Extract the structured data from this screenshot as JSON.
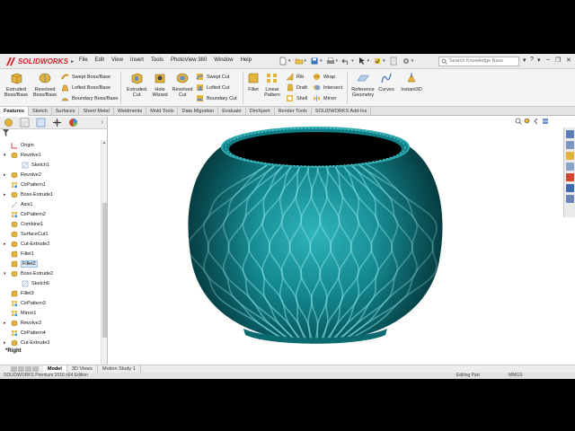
{
  "app": {
    "logo_text": "SOLIDWORKS"
  },
  "menus": [
    "File",
    "Edit",
    "View",
    "Insert",
    "Tools",
    "PhotoView 360",
    "Window",
    "Help"
  ],
  "search": {
    "placeholder": "Search Knowledge Base"
  },
  "commands": {
    "extruded_boss": "Extruded Boss/Base",
    "revolved_boss": "Revolved Boss/Base",
    "swept_boss": "Swept Boss/Base",
    "lofted_boss": "Lofted Boss/Base",
    "boundary_boss": "Boundary Boss/Base",
    "extruded_cut": "Extruded Cut",
    "hole_wizard": "Hole Wizard",
    "revolved_cut": "Revolved Cut",
    "swept_cut": "Swept Cut",
    "lofted_cut": "Lofted Cut",
    "boundary_cut": "Boundary Cut",
    "fillet": "Fillet",
    "linear_pattern": "Linear Pattern",
    "rib": "Rib",
    "draft": "Draft",
    "shell": "Shell",
    "wrap": "Wrap",
    "intersect": "Intersect",
    "mirror": "Mirror",
    "reference_geometry": "Reference Geometry",
    "curves": "Curves",
    "instant3d": "Instant3D"
  },
  "tabs": [
    "Features",
    "Sketch",
    "Surfaces",
    "Sheet Metal",
    "Weldments",
    "Mold Tools",
    "Data Migration",
    "Evaluate",
    "DimXpert",
    "Render Tools",
    "SOLIDWORKS Add-Ins"
  ],
  "tree": [
    {
      "label": "Origin",
      "indent": 0,
      "expand": "",
      "icon": "origin"
    },
    {
      "label": "Revolve1",
      "indent": 0,
      "expand": "▾",
      "icon": "feature"
    },
    {
      "label": "Sketch1",
      "indent": 1,
      "expand": "",
      "icon": "sketch"
    },
    {
      "label": "Revolve2",
      "indent": 0,
      "expand": "▸",
      "icon": "feature"
    },
    {
      "label": "CirPattern1",
      "indent": 0,
      "expand": "",
      "icon": "pattern"
    },
    {
      "label": "Boss-Extrude1",
      "indent": 0,
      "expand": "▸",
      "icon": "feature"
    },
    {
      "label": "Axis1",
      "indent": 0,
      "expand": "",
      "icon": "axis"
    },
    {
      "label": "CirPattern2",
      "indent": 0,
      "expand": "",
      "icon": "pattern"
    },
    {
      "label": "Combine1",
      "indent": 0,
      "expand": "",
      "icon": "feature"
    },
    {
      "label": "SurfaceCut1",
      "indent": 0,
      "expand": "",
      "icon": "feature"
    },
    {
      "label": "Cut-Extrude2",
      "indent": 0,
      "expand": "▸",
      "icon": "feature"
    },
    {
      "label": "Fillet1",
      "indent": 0,
      "expand": "",
      "icon": "fillet"
    },
    {
      "label": "Fillet2",
      "indent": 0,
      "expand": "",
      "icon": "fillet",
      "selected": true
    },
    {
      "label": "Boss-Extrude2",
      "indent": 0,
      "expand": "▾",
      "icon": "feature"
    },
    {
      "label": "Sketch6",
      "indent": 1,
      "expand": "",
      "icon": "sketch"
    },
    {
      "label": "Fillet3",
      "indent": 0,
      "expand": "",
      "icon": "fillet"
    },
    {
      "label": "CirPattern3",
      "indent": 0,
      "expand": "",
      "icon": "pattern"
    },
    {
      "label": "Mirror1",
      "indent": 0,
      "expand": "",
      "icon": "pattern"
    },
    {
      "label": "Revolve3",
      "indent": 0,
      "expand": "▸",
      "icon": "feature"
    },
    {
      "label": "CirPattern4",
      "indent": 0,
      "expand": "",
      "icon": "pattern"
    },
    {
      "label": "Cut-Extrude3",
      "indent": 0,
      "expand": "▸",
      "icon": "feature"
    }
  ],
  "viewport": {
    "view_label": "*Right"
  },
  "bottom_tabs": [
    "Model",
    "3D Views",
    "Motion Study 1"
  ],
  "status": {
    "left": "SOLIDWORKS Premium 2016 x64 Edition",
    "mode": "Editing Part",
    "units": "MMGS"
  },
  "colors": {
    "accent": "#d3202a",
    "vase": "#0e7f86",
    "selection": "#d9e8f7"
  }
}
